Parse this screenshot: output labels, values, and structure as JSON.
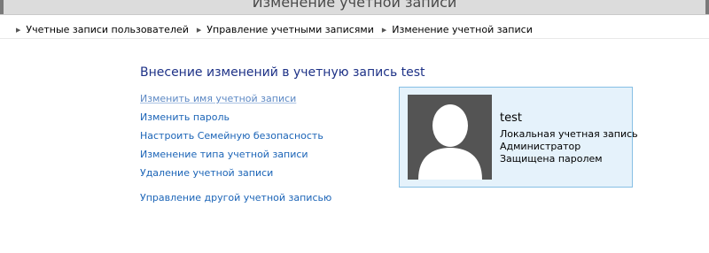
{
  "window": {
    "title": "Изменение учетной записи"
  },
  "breadcrumb": [
    "Учетные записи пользователей",
    "Управление учетными записями",
    "Изменение учетной записи"
  ],
  "main": {
    "heading": "Внесение изменений в учетную запись test",
    "links": {
      "rename": "Изменить имя учетной записи",
      "change_password": "Изменить пароль",
      "family_safety": "Настроить Семейную безопасность",
      "change_type": "Изменение типа учетной записи",
      "delete": "Удаление учетной записи",
      "manage_other": "Управление другой учетной записью"
    }
  },
  "account": {
    "name": "test",
    "type": "Локальная учетная запись",
    "role": "Администратор",
    "status": "Защищена паролем",
    "avatar_icon": "user-silhouette-icon"
  },
  "colors": {
    "link": "#1b64b7",
    "heading": "#1e3287",
    "card_bg": "#e5f2fb",
    "card_border": "#86bfe5",
    "avatar_bg": "#545454"
  }
}
